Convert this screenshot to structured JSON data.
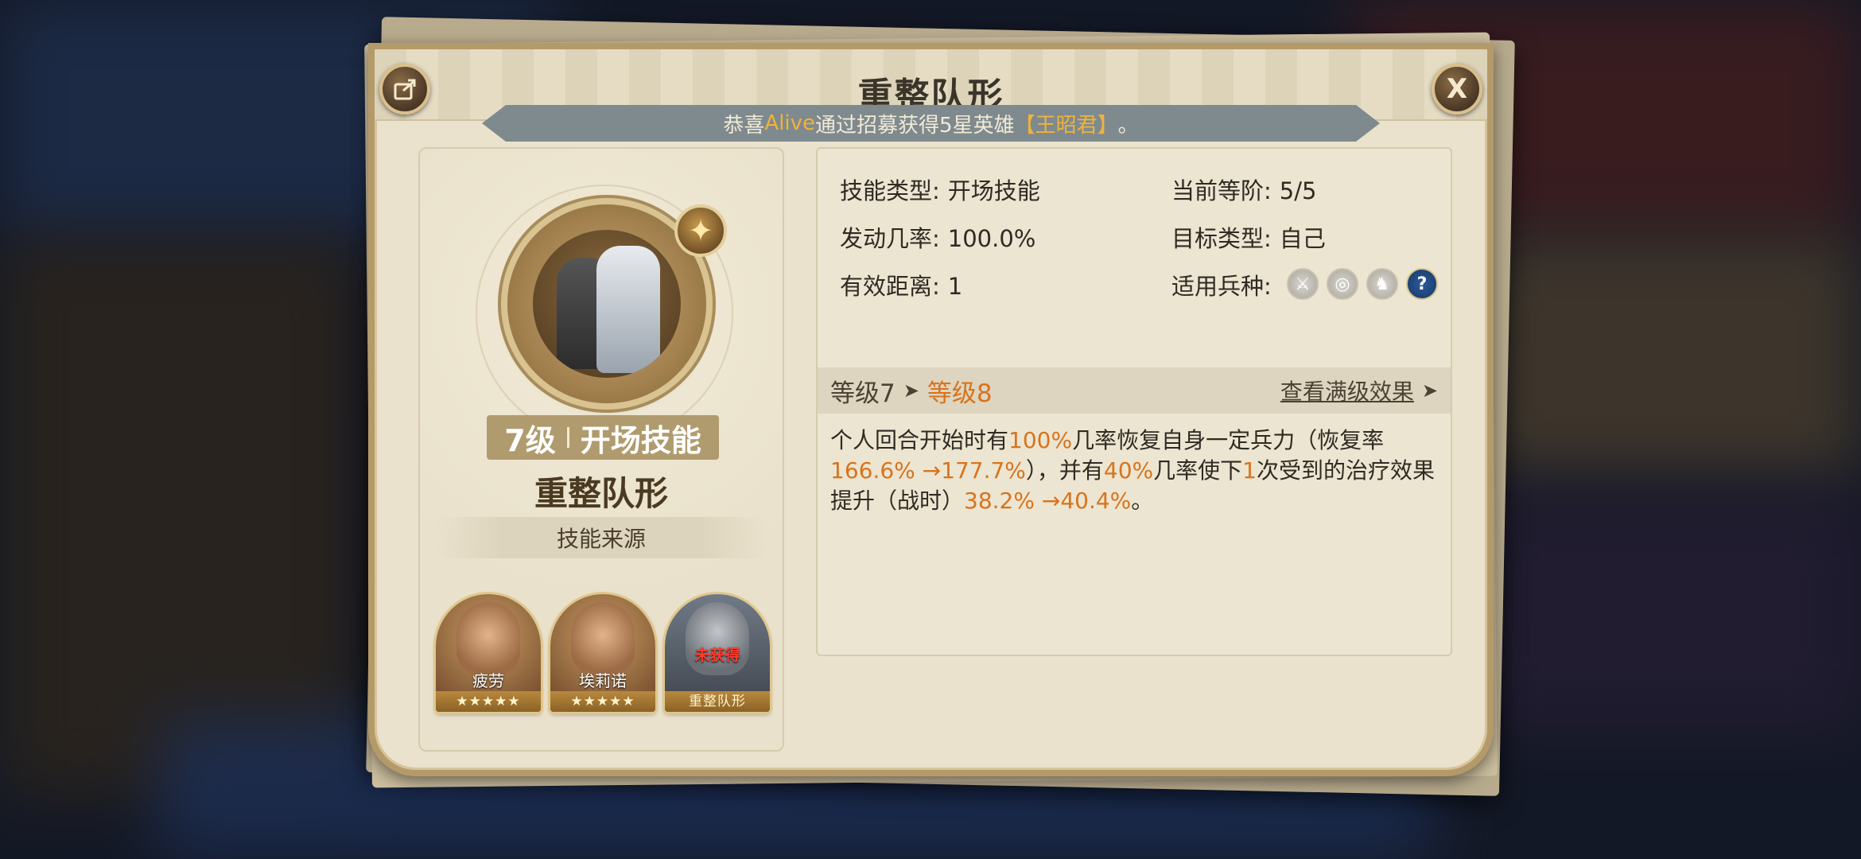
{
  "window": {
    "title": "重整队形",
    "broadcast": {
      "prefix": "恭喜",
      "player": "Alive",
      "middle": "通过招募获得5星英雄",
      "hero": "【王昭君】",
      "suffix": "。"
    },
    "share_icon": "share-icon",
    "close_label": "X"
  },
  "skill": {
    "level_tag": "7级",
    "type_tag": "开场技能",
    "name": "重整队形",
    "source_label": "技能来源",
    "badge_icon": "sparkle-star-icon"
  },
  "heroes": [
    {
      "name": "疲劳",
      "stars": "★★★★★"
    },
    {
      "name": "埃莉诺",
      "stars": "★★★★★"
    },
    {
      "name": "重整队形",
      "locked": "未获得"
    }
  ],
  "info": {
    "type_key": "技能类型:",
    "type_val": "开场技能",
    "stage_key": "当前等阶:",
    "stage_val": "5/5",
    "rate_key": "发动几率:",
    "rate_val": "100.0%",
    "target_key": "目标类型:",
    "target_val": "自己",
    "range_key": "有效距离:",
    "range_val": "1",
    "troop_key": "适用兵种:",
    "troop_icons": [
      "sword-icon",
      "target-icon",
      "horse-icon",
      "question-icon"
    ]
  },
  "level": {
    "current": "等级7",
    "arrow": "➤",
    "next": "等级8",
    "full_link": "查看满级效果",
    "full_arrow": "➤"
  },
  "description": {
    "p1": "个人回合开始时有",
    "v1": "100%",
    "p2": "几率恢复自身一定兵力（恢复率",
    "v2": "166.6% →177.7%",
    "p3": "），并有",
    "v3": "40%",
    "p4": "几率使下",
    "v4": "1",
    "p5": "次受到的治疗效果提升（战时）",
    "v5": "38.2% →40.4%",
    "p6": "。"
  },
  "colors": {
    "highlight": "#d9731c",
    "gold": "#f0b33a",
    "frame": "#b59a69"
  }
}
